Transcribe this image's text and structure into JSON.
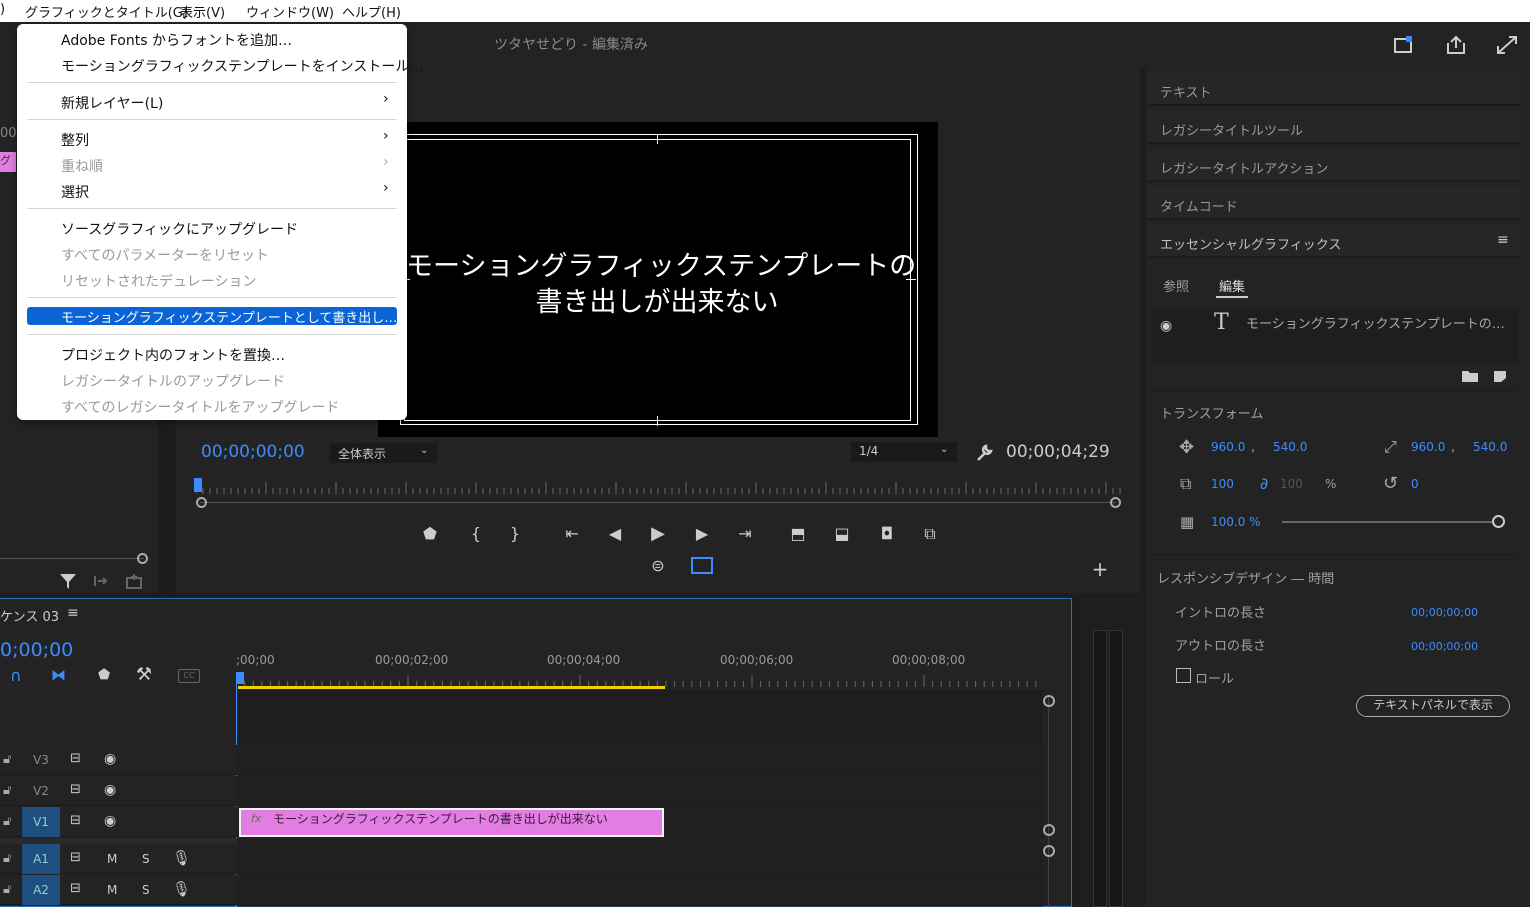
{
  "menubar": {
    "items": [
      ")",
      "グラフィックとタイトル(G)",
      "表示(V)",
      "ウィンドウ(W)",
      "ヘルプ(H)"
    ]
  },
  "app": {
    "title": "ツタヤせどり - 編集済み"
  },
  "dropdown": {
    "items": [
      {
        "label": "Adobe Fonts からフォントを追加…",
        "disabled": false
      },
      {
        "label": "モーショングラフィックステンプレートをインストール…",
        "disabled": false
      },
      {
        "label": "新規レイヤー(L)",
        "disabled": false,
        "submenu": true
      },
      {
        "label": "整列",
        "disabled": false,
        "submenu": true
      },
      {
        "label": "重ね順",
        "disabled": true,
        "submenu": true
      },
      {
        "label": "選択",
        "disabled": false,
        "submenu": true
      },
      {
        "label": "ソースグラフィックにアップグレード",
        "disabled": false
      },
      {
        "label": "すべてのパラメーターをリセット",
        "disabled": true
      },
      {
        "label": "リセットされたデュレーション",
        "disabled": true
      },
      {
        "label": "モーショングラフィックステンプレートとして書き出し…",
        "disabled": false,
        "highlighted": true
      },
      {
        "label": "プロジェクト内のフォントを置換…",
        "disabled": false
      },
      {
        "label": "レガシータイトルのアップグレード",
        "disabled": true
      },
      {
        "label": "すべてのレガシータイトルをアップグレード",
        "disabled": true
      }
    ],
    "submenu_arrow": "›"
  },
  "monitor": {
    "title_line1": "モーショングラフィックステンプレートの",
    "title_line2": "書き出しが出来ない",
    "timecode_current": "00;00;00;00",
    "zoom": "全体表示",
    "resolution": "1/4",
    "timecode_duration": "00;00;04;29"
  },
  "left": {
    "frag1": "00",
    "frag2": "グラ"
  },
  "rightpanel": {
    "sections": [
      "テキスト",
      "レガシータイトルツール",
      "レガシータイトルアクション",
      "タイムコード",
      "エッセンシャルグラフィックス"
    ],
    "tabs": [
      "参照",
      "編集"
    ],
    "layer_name": "モーショングラフィックステンプレートの…",
    "transform_label": "トランスフォーム",
    "pos_x": "960.0",
    "pos_y": "540.0",
    "anchor_x": "960.0",
    "anchor_y": "540.0",
    "comma": ",",
    "scale": "100",
    "scale2": "100",
    "percent": "%",
    "rotation": "0",
    "opacity": "100.0 %",
    "responsive_label": "レスポンシブデザイン ― 時間",
    "intro_label": "イントロの長さ",
    "intro_value": "00;00;00;00",
    "outro_label": "アウトロの長さ",
    "outro_value": "00;00;00;00",
    "roll_label": "ロール",
    "text_panel_button": "テキストパネルで表示"
  },
  "timeline": {
    "sequence_name": "ケンス 03",
    "timecode": "0;00;00",
    "ruler": [
      ";00;00",
      "00;00;02;00",
      "00;00;04;00",
      "00;00;06;00",
      "00;00;08;00"
    ],
    "tracks": [
      "V3",
      "V2",
      "V1",
      "A1",
      "A2"
    ],
    "clip_label": "モーショングラフィックステンプレートの書き出しが出来ない",
    "m": "M",
    "s": "S"
  },
  "colors": {
    "accent": "#3c8cff",
    "clip": "#e27ee2",
    "highlight": "#0a64d6",
    "playhead_bar": "#f0d000"
  }
}
